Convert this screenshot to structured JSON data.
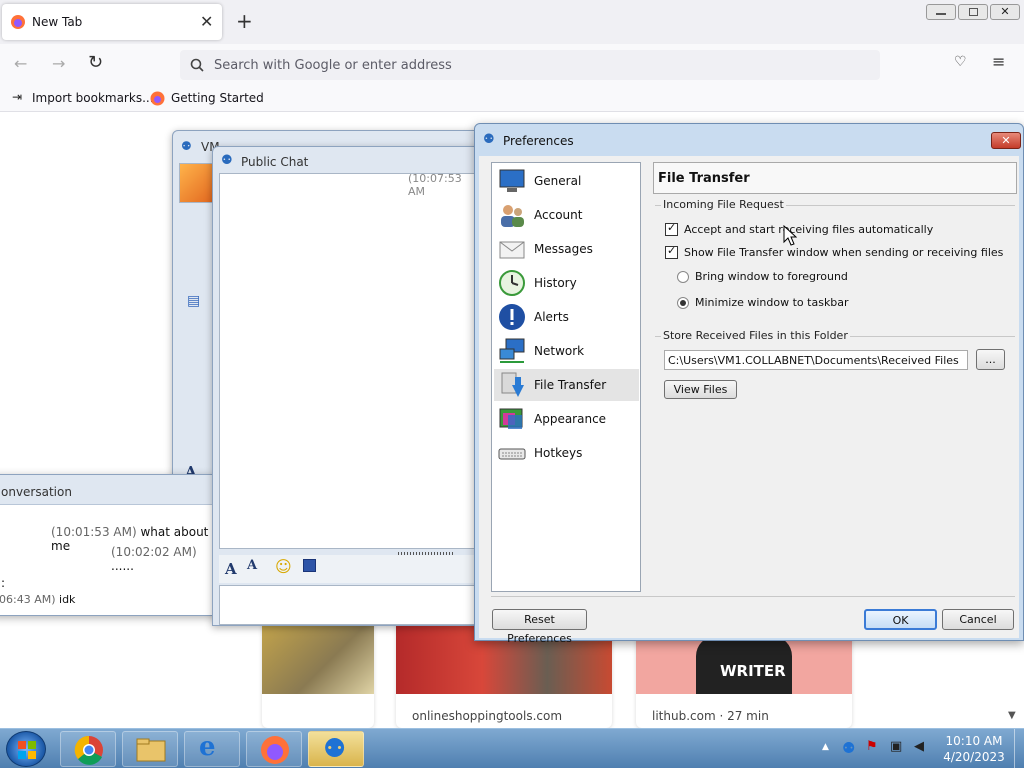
{
  "browser": {
    "tab_title": "New Tab",
    "url_placeholder": "Search with Google or enter address",
    "bookmarks": [
      "Import bookmarks...",
      "Getting Started"
    ]
  },
  "content_cards": [
    {
      "caption": "onlineshoppingtools.com"
    },
    {
      "caption": "lithub.com · 27 min",
      "image_text": "WRITER"
    }
  ],
  "vm_window": {
    "title": "VM"
  },
  "public_chat": {
    "title": "Public Chat",
    "timestamp": "(10:07:53 AM"
  },
  "conversation": {
    "title": "onversation",
    "messages": [
      {
        "time": "(10:01:53 AM)",
        "text": "what about me"
      },
      {
        "time": "(10:02:02 AM)",
        "text": "......"
      },
      {
        "time": ":",
        "text": ""
      },
      {
        "time": "06:43 AM)",
        "text": "idk"
      }
    ]
  },
  "preferences": {
    "title": "Preferences",
    "nav": [
      "General",
      "Account",
      "Messages",
      "History",
      "Alerts",
      "Network",
      "File Transfer",
      "Appearance",
      "Hotkeys"
    ],
    "selected": "File Transfer",
    "section_title": "File Transfer",
    "incoming_group": "Incoming File Request",
    "accept_auto": "Accept and start receiving files automatically",
    "show_window": "Show File Transfer window when sending or receiving files",
    "bring_foreground": "Bring window to foreground",
    "minimize_taskbar": "Minimize window to taskbar",
    "store_group": "Store Received Files in this Folder",
    "folder_path": "C:\\Users\\VM1.COLLABNET\\Documents\\Received Files",
    "browse_label": "...",
    "view_files": "View Files",
    "reset": "Reset Preferences",
    "ok": "OK",
    "cancel": "Cancel"
  },
  "taskbar": {
    "time": "10:10 AM",
    "date": "4/20/2023"
  }
}
